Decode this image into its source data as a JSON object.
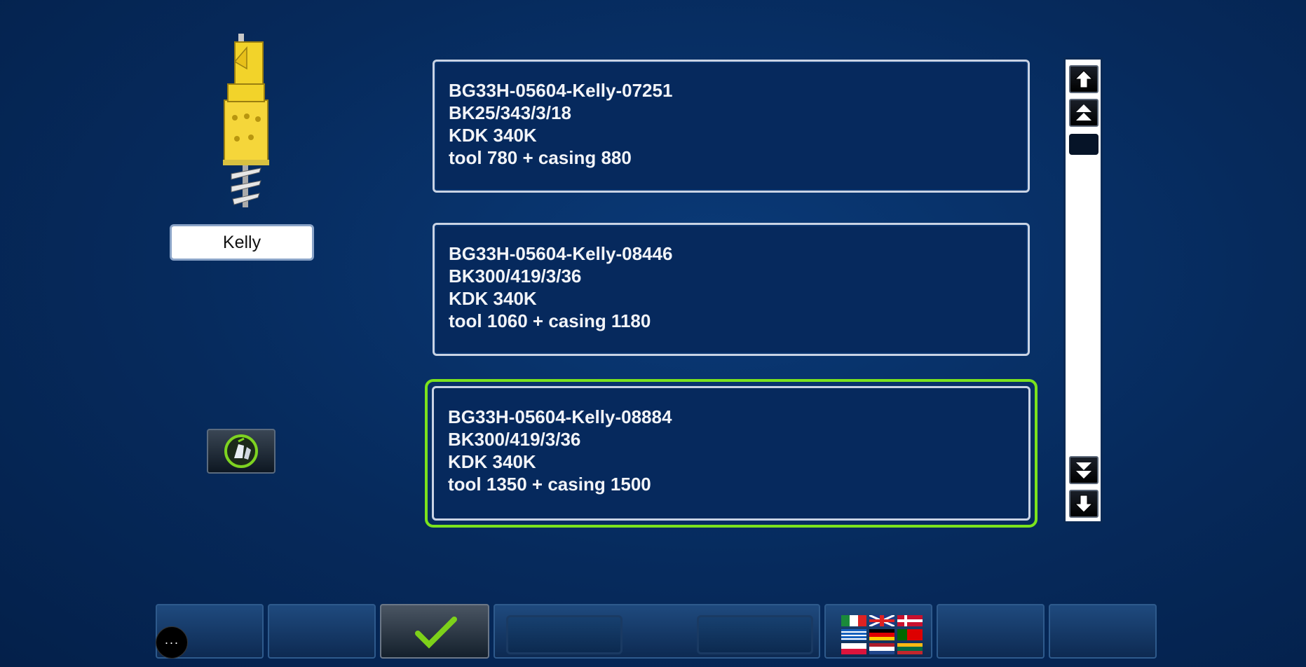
{
  "tool": {
    "label": "Kelly"
  },
  "entries": [
    {
      "lines": [
        "BG33H-05604-Kelly-07251",
        "BK25/343/3/18",
        "KDK 340K",
        "tool 780 + casing 880"
      ]
    },
    {
      "lines": [
        "BG33H-05604-Kelly-08446",
        "BK300/419/3/36",
        "KDK 340K",
        "tool 1060 + casing 1180"
      ]
    },
    {
      "lines": [
        "BG33H-05604-Kelly-08884",
        "BK300/419/3/36",
        "KDK 340K",
        "tool 1350 + casing 1500"
      ],
      "selected": true
    }
  ],
  "colors": {
    "background": "#062a5c",
    "selection": "#7be31d",
    "text": "#f2f4f8",
    "confirm": "#7dd11a"
  },
  "icons": {
    "scroll_up": "arrow-up-icon",
    "page_up": "double-chevron-up-icon",
    "page_down": "double-chevron-down-icon",
    "scroll_down": "arrow-down-icon",
    "confirm": "checkmark-icon",
    "language": "flags-icon",
    "more": "ellipsis-icon"
  },
  "more_button": {
    "label": "···"
  }
}
